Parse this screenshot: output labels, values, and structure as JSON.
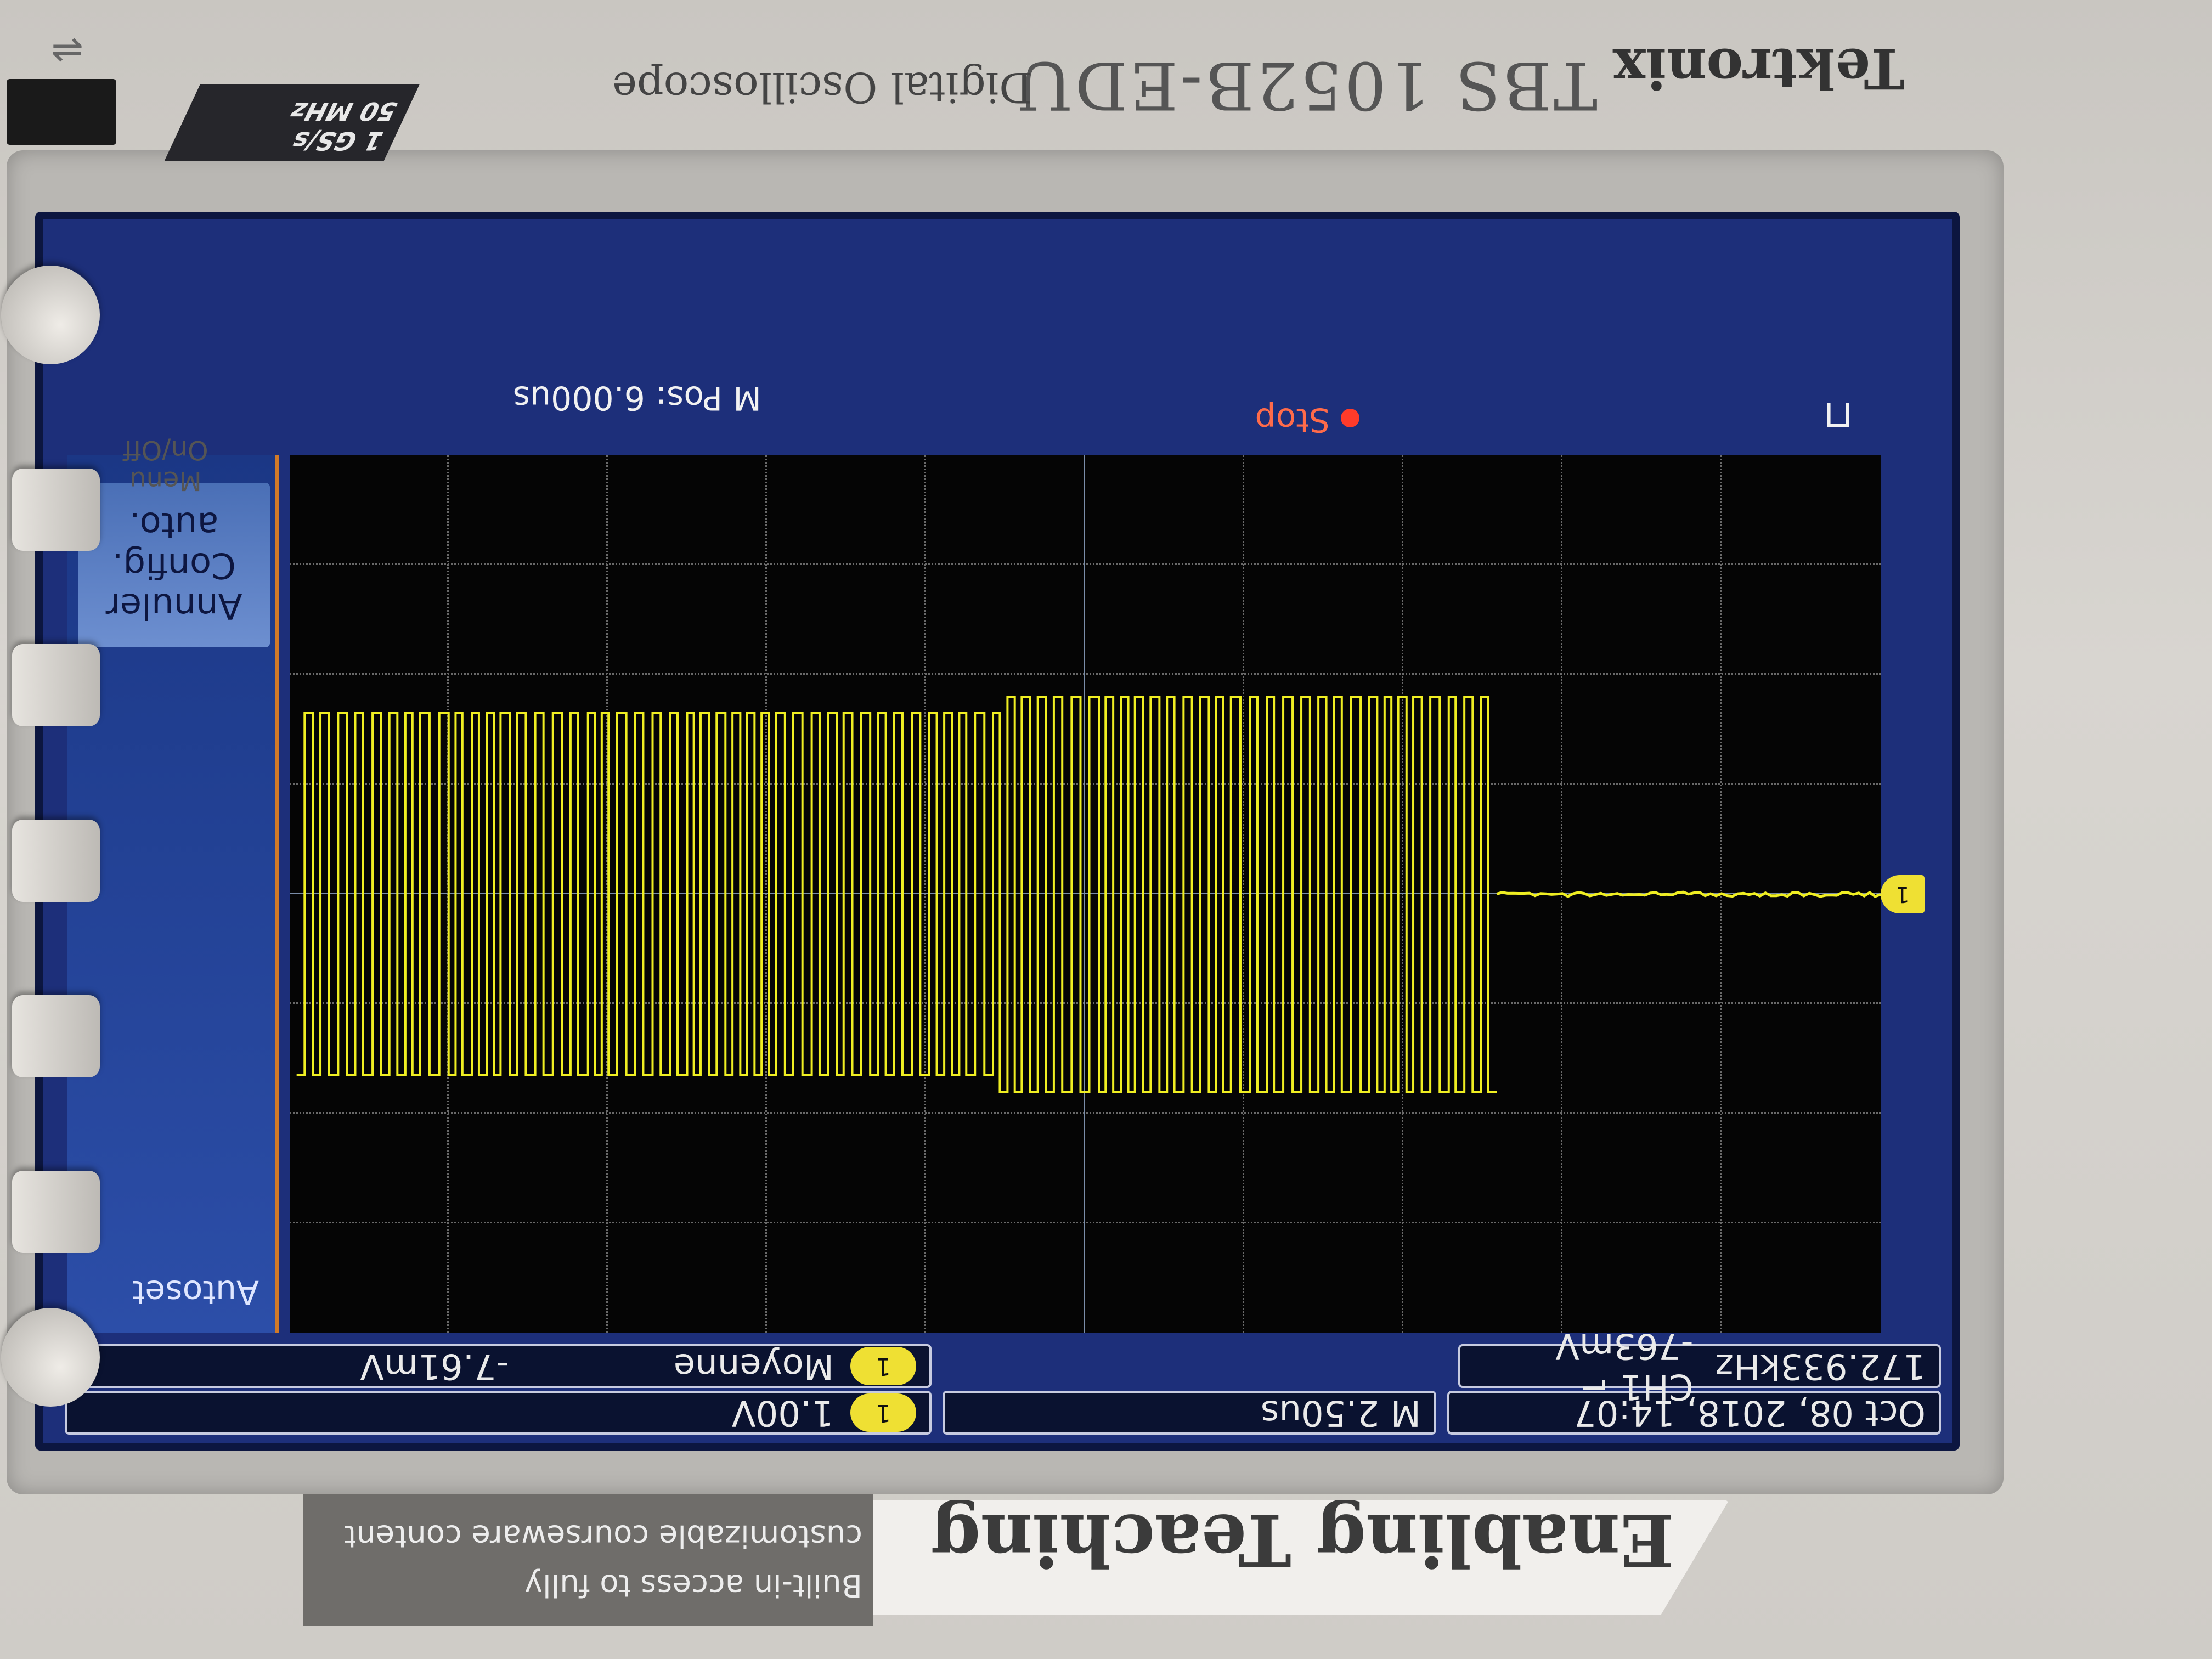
{
  "top_banner": {
    "title": "Enabling Teaching",
    "subtitle": "Built-in access to fully customizable courseware content"
  },
  "device": {
    "brand": "Tektronix",
    "model": "TBS 1052B-EDU",
    "type": "Digital Oscilloscope",
    "spec_bandwidth": "50 MHz",
    "spec_sample_rate": "1 GS/s",
    "menu_button_label": "Menu On/Off"
  },
  "screen": {
    "channel_badge": "1",
    "volts_per_div": "1.00V",
    "measure_name": "Moyenne",
    "measure_value": "-7.61mV",
    "timebase": "M 2.50us",
    "trigger_info": "CH1 ⌐ -763mV",
    "frequency": "172.933kHz",
    "datetime": "Oct 08, 2018, 14:07",
    "position": "M Pos: 6.000us",
    "status": "Stop",
    "side_title": "Autoset",
    "side_button_line1": "Annuler",
    "side_button_line2": "Config. auto.",
    "trace_color": "#efee22",
    "grid_color": "#6a6a6a",
    "panel_color": "#1d2f7a"
  }
}
